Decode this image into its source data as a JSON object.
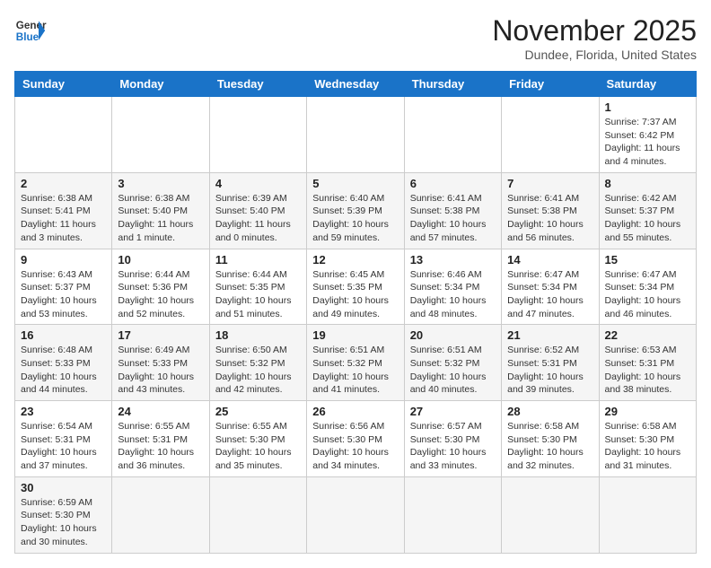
{
  "header": {
    "logo_line1": "General",
    "logo_line2": "Blue",
    "month_title": "November 2025",
    "location": "Dundee, Florida, United States"
  },
  "weekdays": [
    "Sunday",
    "Monday",
    "Tuesday",
    "Wednesday",
    "Thursday",
    "Friday",
    "Saturday"
  ],
  "weeks": [
    [
      {
        "day": "",
        "info": ""
      },
      {
        "day": "",
        "info": ""
      },
      {
        "day": "",
        "info": ""
      },
      {
        "day": "",
        "info": ""
      },
      {
        "day": "",
        "info": ""
      },
      {
        "day": "",
        "info": ""
      },
      {
        "day": "1",
        "info": "Sunrise: 7:37 AM\nSunset: 6:42 PM\nDaylight: 11 hours\nand 4 minutes."
      }
    ],
    [
      {
        "day": "2",
        "info": "Sunrise: 6:38 AM\nSunset: 5:41 PM\nDaylight: 11 hours\nand 3 minutes."
      },
      {
        "day": "3",
        "info": "Sunrise: 6:38 AM\nSunset: 5:40 PM\nDaylight: 11 hours\nand 1 minute."
      },
      {
        "day": "4",
        "info": "Sunrise: 6:39 AM\nSunset: 5:40 PM\nDaylight: 11 hours\nand 0 minutes."
      },
      {
        "day": "5",
        "info": "Sunrise: 6:40 AM\nSunset: 5:39 PM\nDaylight: 10 hours\nand 59 minutes."
      },
      {
        "day": "6",
        "info": "Sunrise: 6:41 AM\nSunset: 5:38 PM\nDaylight: 10 hours\nand 57 minutes."
      },
      {
        "day": "7",
        "info": "Sunrise: 6:41 AM\nSunset: 5:38 PM\nDaylight: 10 hours\nand 56 minutes."
      },
      {
        "day": "8",
        "info": "Sunrise: 6:42 AM\nSunset: 5:37 PM\nDaylight: 10 hours\nand 55 minutes."
      }
    ],
    [
      {
        "day": "9",
        "info": "Sunrise: 6:43 AM\nSunset: 5:37 PM\nDaylight: 10 hours\nand 53 minutes."
      },
      {
        "day": "10",
        "info": "Sunrise: 6:44 AM\nSunset: 5:36 PM\nDaylight: 10 hours\nand 52 minutes."
      },
      {
        "day": "11",
        "info": "Sunrise: 6:44 AM\nSunset: 5:35 PM\nDaylight: 10 hours\nand 51 minutes."
      },
      {
        "day": "12",
        "info": "Sunrise: 6:45 AM\nSunset: 5:35 PM\nDaylight: 10 hours\nand 49 minutes."
      },
      {
        "day": "13",
        "info": "Sunrise: 6:46 AM\nSunset: 5:34 PM\nDaylight: 10 hours\nand 48 minutes."
      },
      {
        "day": "14",
        "info": "Sunrise: 6:47 AM\nSunset: 5:34 PM\nDaylight: 10 hours\nand 47 minutes."
      },
      {
        "day": "15",
        "info": "Sunrise: 6:47 AM\nSunset: 5:34 PM\nDaylight: 10 hours\nand 46 minutes."
      }
    ],
    [
      {
        "day": "16",
        "info": "Sunrise: 6:48 AM\nSunset: 5:33 PM\nDaylight: 10 hours\nand 44 minutes."
      },
      {
        "day": "17",
        "info": "Sunrise: 6:49 AM\nSunset: 5:33 PM\nDaylight: 10 hours\nand 43 minutes."
      },
      {
        "day": "18",
        "info": "Sunrise: 6:50 AM\nSunset: 5:32 PM\nDaylight: 10 hours\nand 42 minutes."
      },
      {
        "day": "19",
        "info": "Sunrise: 6:51 AM\nSunset: 5:32 PM\nDaylight: 10 hours\nand 41 minutes."
      },
      {
        "day": "20",
        "info": "Sunrise: 6:51 AM\nSunset: 5:32 PM\nDaylight: 10 hours\nand 40 minutes."
      },
      {
        "day": "21",
        "info": "Sunrise: 6:52 AM\nSunset: 5:31 PM\nDaylight: 10 hours\nand 39 minutes."
      },
      {
        "day": "22",
        "info": "Sunrise: 6:53 AM\nSunset: 5:31 PM\nDaylight: 10 hours\nand 38 minutes."
      }
    ],
    [
      {
        "day": "23",
        "info": "Sunrise: 6:54 AM\nSunset: 5:31 PM\nDaylight: 10 hours\nand 37 minutes."
      },
      {
        "day": "24",
        "info": "Sunrise: 6:55 AM\nSunset: 5:31 PM\nDaylight: 10 hours\nand 36 minutes."
      },
      {
        "day": "25",
        "info": "Sunrise: 6:55 AM\nSunset: 5:30 PM\nDaylight: 10 hours\nand 35 minutes."
      },
      {
        "day": "26",
        "info": "Sunrise: 6:56 AM\nSunset: 5:30 PM\nDaylight: 10 hours\nand 34 minutes."
      },
      {
        "day": "27",
        "info": "Sunrise: 6:57 AM\nSunset: 5:30 PM\nDaylight: 10 hours\nand 33 minutes."
      },
      {
        "day": "28",
        "info": "Sunrise: 6:58 AM\nSunset: 5:30 PM\nDaylight: 10 hours\nand 32 minutes."
      },
      {
        "day": "29",
        "info": "Sunrise: 6:58 AM\nSunset: 5:30 PM\nDaylight: 10 hours\nand 31 minutes."
      }
    ],
    [
      {
        "day": "30",
        "info": "Sunrise: 6:59 AM\nSunset: 5:30 PM\nDaylight: 10 hours\nand 30 minutes."
      },
      {
        "day": "",
        "info": ""
      },
      {
        "day": "",
        "info": ""
      },
      {
        "day": "",
        "info": ""
      },
      {
        "day": "",
        "info": ""
      },
      {
        "day": "",
        "info": ""
      },
      {
        "day": "",
        "info": ""
      }
    ]
  ]
}
